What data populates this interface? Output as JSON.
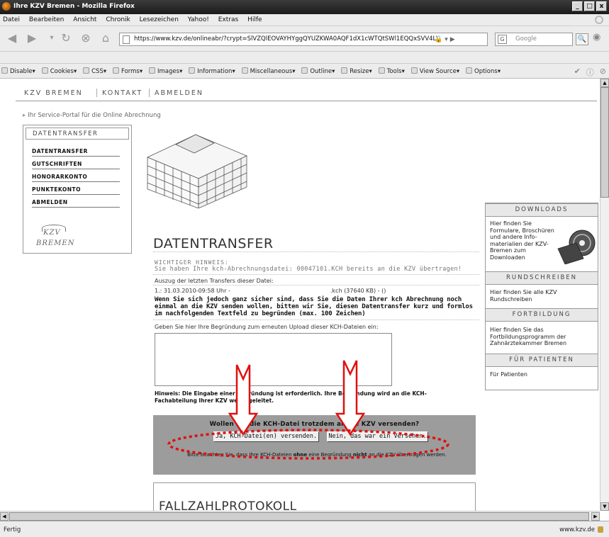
{
  "window": {
    "title": "Ihre KZV Bremen - Mozilla Firefox",
    "buttons": [
      "_",
      "□",
      "x"
    ]
  },
  "menubar": {
    "items": [
      "Datei",
      "Bearbeiten",
      "Ansicht",
      "Chronik",
      "Lesezeichen",
      "Yahoo!",
      "Extras",
      "Hilfe"
    ]
  },
  "navbar": {
    "url": "https://www.kzv.de/onlineabr/?crypt=SlVZQlEOVAYHYggQYUZKWA0AQF1dX1cWTQtSWl1EQQxSVV4L\\",
    "search_placeholder": "Google",
    "search_engine_icon": "G"
  },
  "devbar": {
    "items": [
      "Disable",
      "Cookies",
      "CSS",
      "Forms",
      "Images",
      "Information",
      "Miscellaneous",
      "Outline",
      "Resize",
      "Tools",
      "View Source",
      "Options"
    ]
  },
  "site": {
    "topnav": [
      "KZV BREMEN",
      "KONTAKT",
      "ABMELDEN"
    ],
    "breadcrumb": "Ihr Service-Portal für die Online Abrechnung",
    "leftnav": {
      "header": "DATENTRANSFER",
      "links": [
        "DATENTRANSFER",
        "GUTSCHRIFTEN",
        "HONORARKONTO",
        "PUNKTEKONTO",
        "ABMELDEN"
      ]
    },
    "logo": {
      "line1": "KZV",
      "line2": "BREMEN"
    },
    "main": {
      "title": "DATENTRANSFER",
      "warning_header": "WICHTIGER HINWEIS:",
      "warning_text": "Sie haben Ihre kch-Abrechnungsdatei: 00047101.KCH bereits an die KZV übertragen!",
      "transfers_label": "Auszug der letzten Transfers dieser Datei:",
      "transfer_date": "1.: 31.03.2010-09:58 Uhr -",
      "transfer_file": ".kch (37640 KB) - ()",
      "confirm_text": "Wenn Sie sich jedoch ganz sicher sind, dass Sie die Daten Ihrer kch Abrechnung noch einmal an die KZV senden wollen, bitten wir Sie, diesen Datentransfer kurz und formlos im nachfolgenden Textfeld zu begründen (max. 100 Zeichen)",
      "reason_label": "Geben Sie hier Ihre Begründung zum erneuten Upload dieser KCH-Dateien ein:",
      "reason_value": "",
      "hint": "Hinweis: Die Eingabe einer Begründung ist erforderlich. Ihre Begründung wird an die KCH-Fachabteilung Ihrer KZV weitergeleitet.",
      "question": "Wollen Sie die KCH-Datei trotzdem an die KZV versenden?",
      "btn_yes": "Ja, KCH-Datei(en) versenden.",
      "btn_no": "Nein, das war ein Versehen.",
      "note_pre": "Bitte beachten Sie, dass Ihre KCH-Dateien ",
      "note_b1": "ohne",
      "note_mid": " eine Begründung ",
      "note_b2": "nicht",
      "note_post": " an die KZV übertragen werden.",
      "fall_title": "FALLZAHLPROTOKOLL"
    },
    "right": {
      "downloads_hdr": "DOWNLOADS",
      "downloads_txt": "Hier finden Sie Formulare, Broschüren und andere Info-materialien der KZV-Bremen zum Downloaden",
      "rund_hdr": "RUNDSCHREIBEN",
      "rund_txt": "Hier finden Sie alle KZV Rundschreiben",
      "fort_hdr": "FORTBILDUNG",
      "fort_txt": "Hier finden Sie das Fortbildungsprogramm der Zahnärztekammer Bremen",
      "pat_hdr": "FÜR PATIENTEN",
      "pat_txt": "Für Patienten"
    }
  },
  "status": {
    "text": "Fertig",
    "domain": "www.kzv.de"
  },
  "annotation_color": "#e01010"
}
